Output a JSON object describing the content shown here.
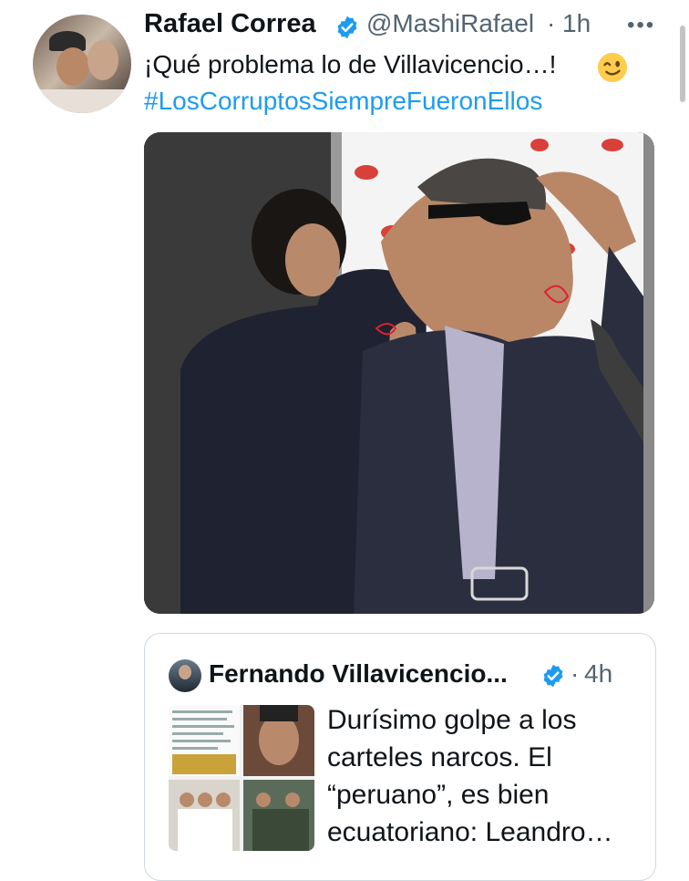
{
  "tweet": {
    "author_name": "Rafael Correa",
    "handle": "@MashiRafael",
    "separator": "·",
    "time": "1h",
    "more_label": "•••",
    "text": "¡Qué problema lo de Villavicencio…!",
    "hashtag": "#LosCorruptosSiempreFueronEllos"
  },
  "quoted": {
    "author_name": "Fernando Villavicencio...",
    "separator": "·",
    "time": "4h",
    "text": "Durísimo golpe a los carteles narcos. El “peruano”, es bien ecuatoriano: Leandro…"
  },
  "colors": {
    "link": "#1d9bf0",
    "secondary": "#536471",
    "verified": "#1d9bf0",
    "border": "#cfd9de"
  },
  "icons": [
    "verified-badge-icon",
    "wink-emoji-icon",
    "more-options-icon"
  ]
}
